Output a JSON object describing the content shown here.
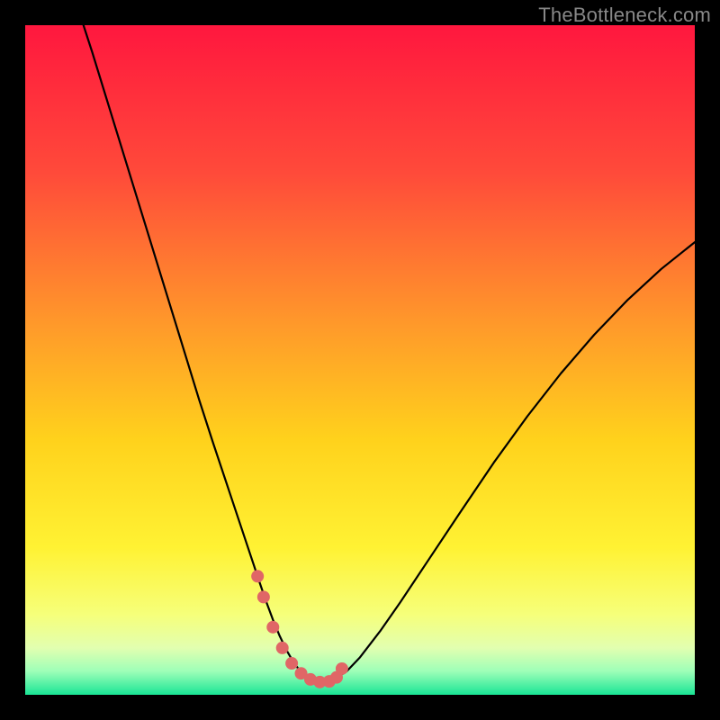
{
  "watermark": "TheBottleneck.com",
  "chart_data": {
    "type": "line",
    "title": "",
    "xlabel": "",
    "ylabel": "",
    "xlim": [
      0,
      100
    ],
    "ylim": [
      0,
      100
    ],
    "gradient_stops": [
      {
        "offset": 0.0,
        "color": "#ff173e"
      },
      {
        "offset": 0.22,
        "color": "#ff4a3a"
      },
      {
        "offset": 0.45,
        "color": "#ff9a2a"
      },
      {
        "offset": 0.62,
        "color": "#ffd21c"
      },
      {
        "offset": 0.78,
        "color": "#fff233"
      },
      {
        "offset": 0.88,
        "color": "#f6ff7a"
      },
      {
        "offset": 0.93,
        "color": "#e2ffb0"
      },
      {
        "offset": 0.965,
        "color": "#9dffb8"
      },
      {
        "offset": 1.0,
        "color": "#19e595"
      }
    ],
    "series": [
      {
        "name": "bottleneck-curve",
        "x": [
          8.7,
          10,
          12,
          14,
          16,
          18,
          20,
          22,
          24,
          26,
          28,
          30,
          32,
          34,
          35,
          36,
          37,
          38,
          39,
          40,
          41,
          42,
          43,
          44,
          45,
          46,
          48,
          50,
          53,
          56,
          60,
          65,
          70,
          75,
          80,
          85,
          90,
          95,
          100
        ],
        "y": [
          100,
          96,
          89.5,
          83,
          76.5,
          70,
          63.5,
          57,
          50.5,
          44,
          37.8,
          31.8,
          25.8,
          19.8,
          16.8,
          13.9,
          11.2,
          8.8,
          6.7,
          5.0,
          3.6,
          2.6,
          2.0,
          1.9,
          1.9,
          2.2,
          3.5,
          5.6,
          9.5,
          13.8,
          19.8,
          27.3,
          34.7,
          41.6,
          48.0,
          53.8,
          59.0,
          63.6,
          67.6
        ]
      }
    ],
    "marker_points": {
      "name": "trough-markers",
      "color": "#e06666",
      "radius_px": 7,
      "x": [
        34.7,
        35.6,
        37.0,
        38.4,
        39.8,
        41.2,
        42.6,
        44.0,
        45.4,
        46.5,
        47.3
      ],
      "y": [
        17.7,
        14.6,
        10.1,
        7.0,
        4.7,
        3.2,
        2.3,
        1.9,
        2.0,
        2.6,
        3.9
      ]
    }
  }
}
